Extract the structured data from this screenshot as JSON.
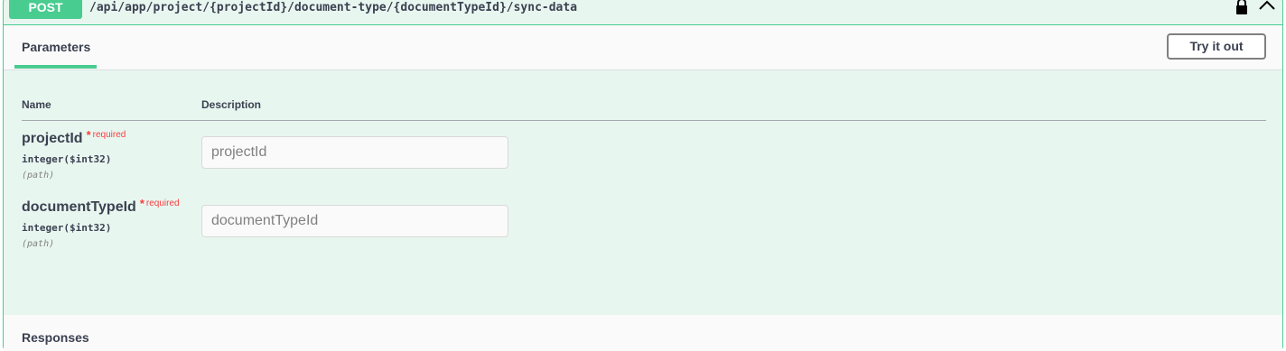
{
  "operation": {
    "method": "POST",
    "path": "/api/app/project/{projectId}/document-type/{documentTypeId}/sync-data",
    "lock_icon": "lock-icon",
    "collapse_icon": "chevron-up-icon"
  },
  "colors": {
    "post_accent": "#49cc90",
    "post_background": "#e8f6f0",
    "required_red": "#f93e3e"
  },
  "parameters_section": {
    "tab_label": "Parameters",
    "try_button_label": "Try it out",
    "columns": {
      "name": "Name",
      "description": "Description"
    },
    "items": [
      {
        "name": "projectId",
        "star": "*",
        "required_label": "required",
        "type": "integer($int32)",
        "in": "(path)",
        "placeholder": "projectId"
      },
      {
        "name": "documentTypeId",
        "star": "*",
        "required_label": "required",
        "type": "integer($int32)",
        "in": "(path)",
        "placeholder": "documentTypeId"
      }
    ]
  },
  "responses_section": {
    "title": "Responses"
  }
}
